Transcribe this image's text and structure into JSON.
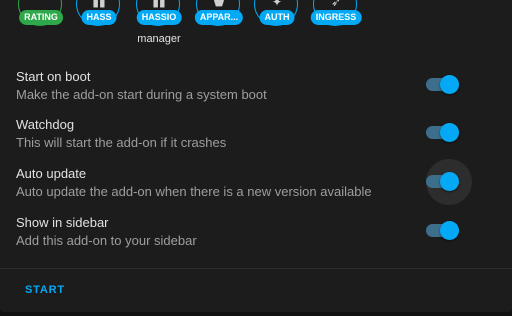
{
  "badges": [
    {
      "label": "RATING",
      "glyph": "",
      "color": "#2ea84a"
    },
    {
      "label": "HASS",
      "glyph": "▮▮",
      "color": "#03a9f4"
    },
    {
      "label": "HASSIO",
      "glyph": "▮▮",
      "color": "#03a9f4",
      "sublabel": "manager"
    },
    {
      "label": "APPAR...",
      "glyph": "⬟",
      "color": "#03a9f4"
    },
    {
      "label": "AUTH",
      "glyph": "✦",
      "color": "#03a9f4"
    },
    {
      "label": "INGRESS",
      "glyph": "➶",
      "color": "#03a9f4"
    }
  ],
  "options": [
    {
      "title": "Start on boot",
      "description": "Make the add-on start during a system boot",
      "enabled": true
    },
    {
      "title": "Watchdog",
      "description": "This will start the add-on if it crashes",
      "enabled": true
    },
    {
      "title": "Auto update",
      "description": "Auto update the add-on when there is a new version available",
      "enabled": true,
      "focused": true
    },
    {
      "title": "Show in sidebar",
      "description": "Add this add-on to your sidebar",
      "enabled": true
    }
  ],
  "actions": {
    "start_label": "START"
  },
  "colors": {
    "accent": "#03a9f4",
    "rating_green": "#2ea84a",
    "card_background": "#1c1c1c"
  }
}
